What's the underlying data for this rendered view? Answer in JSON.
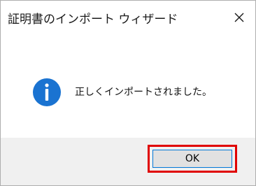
{
  "window": {
    "title": "証明書のインポート ウィザード"
  },
  "icons": {
    "close": "close-icon",
    "info": "info-icon"
  },
  "message": {
    "text": "正しくインポートされました。"
  },
  "buttons": {
    "ok_label": "OK"
  },
  "colors": {
    "info_icon_fill": "#1a73d1",
    "ok_focus_border": "#0078d7",
    "annotation_highlight": "#e00000",
    "footer_background": "#f0f0f0"
  }
}
